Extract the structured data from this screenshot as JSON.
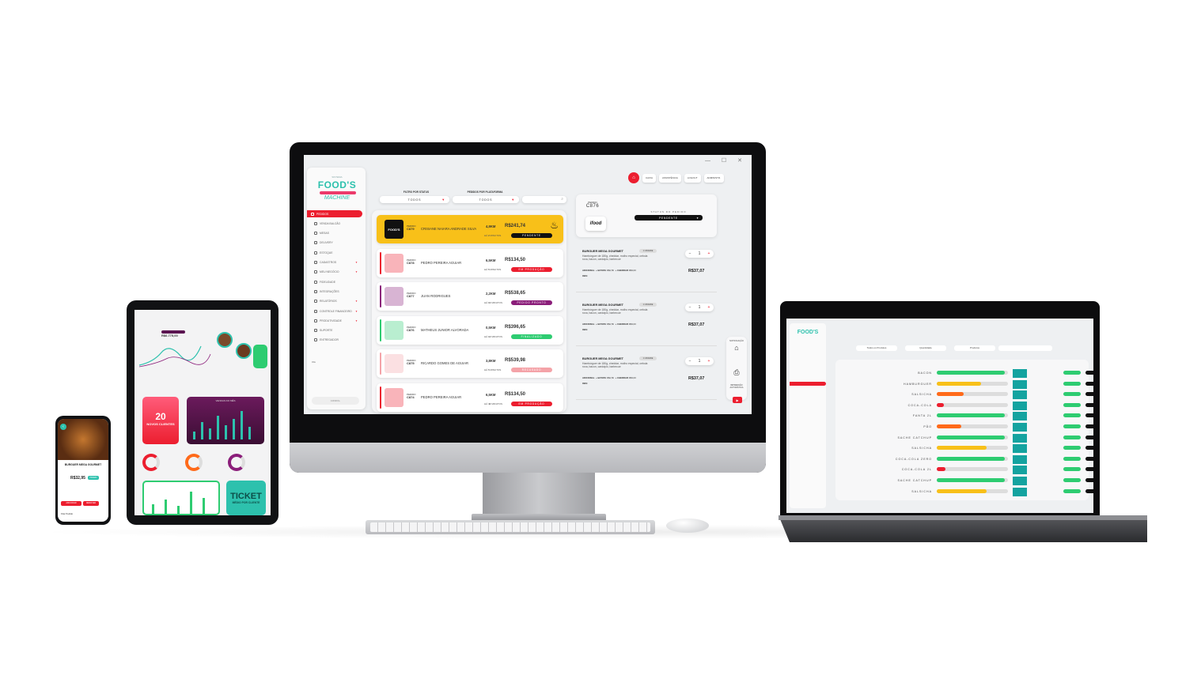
{
  "brand": {
    "top": "SISTEMA",
    "main": "FOOD'S",
    "sub": "MACHINE"
  },
  "monitor": {
    "window_controls": "— ☐ ✕",
    "topbar": [
      "CAIXA",
      "ASSISTÊNCIA",
      "LOGOUT",
      "ADMINISTR."
    ],
    "sidebar": {
      "items": [
        {
          "label": "PEDIDOS",
          "active": true
        },
        {
          "label": "VENDA BALCÃO"
        },
        {
          "label": "MESAS"
        },
        {
          "label": "DELIVERY"
        },
        {
          "label": "ESTOQUE"
        },
        {
          "label": "CADASTROS",
          "caret": true
        },
        {
          "label": "MEU NEGÓCIO",
          "caret": true
        },
        {
          "label": "FIDELIDADE"
        },
        {
          "label": "INTEGRAÇÕES"
        },
        {
          "label": "RELATÓRIOS",
          "caret": true
        },
        {
          "label": "CONTROLE FINANCEIRO",
          "caret": true
        },
        {
          "label": "PRODUTIVIDADE",
          "caret": true
        },
        {
          "label": "SUPORTE"
        },
        {
          "label": "ENTREGADOR"
        }
      ],
      "user": "Olá",
      "footer": "CONFIG."
    },
    "filters": {
      "status_label": "FILTRO POR STATUS",
      "status_value": "TODOS",
      "platform_label": "PEDIDOS POR PLATAFORMA",
      "platform_value": "TODOS",
      "search_icon": "magnifier-icon"
    },
    "orders": [
      {
        "pedido": "PEDIDO",
        "num": "C879",
        "name": "CRISIANE NAIARA ANDRADE SILVA",
        "dist": "4,9KM",
        "price": "R$241,74",
        "time_pre": "HÁ",
        "time_num": "2",
        "time_post": "MINUTOS",
        "status": "PENDENTE",
        "status_color": "#111111",
        "bar_color": "#f8c019",
        "selected": true
      },
      {
        "pedido": "PEDIDO",
        "num": "C878",
        "name": "PEDRO PEREIRA AGUIAR",
        "dist": "6,5KM",
        "price": "R$134,50",
        "time_pre": "HÁ",
        "time_num": "5",
        "time_post": "MINUTOS",
        "status": "EM PRODUÇÃO",
        "status_color": "#ec1e2f",
        "bar_color": "#ec1e2f"
      },
      {
        "pedido": "PEDIDO",
        "num": "C877",
        "name": "JUAN RODRIGUES",
        "dist": "2,2KM",
        "price": "R$538,65",
        "time_pre": "HÁ",
        "time_num": "10",
        "time_post": "MINUTOS",
        "status": "PEDIDO PRONTO",
        "status_color": "#8b1e7a",
        "bar_color": "#8b1e7a"
      },
      {
        "pedido": "PEDIDO",
        "num": "C876",
        "name": "MATHEUS JUNIOR ALVORADA",
        "dist": "0,5KM",
        "price": "R$396,65",
        "time_pre": "HÁ",
        "time_num": "12",
        "time_post": "MINUTOS",
        "status": "FINALIZADO",
        "status_color": "#2ecc71",
        "bar_color": "#2ecc71"
      },
      {
        "pedido": "PEDIDO",
        "num": "C875",
        "name": "RICARDO GOMES DE AGUIAR",
        "dist": "3,8KM",
        "price": "R$539,98",
        "time_pre": "HÁ",
        "time_num": "5",
        "time_post": "MINUTOS",
        "status": "RECUSADO",
        "status_color": "#f4a3a8",
        "bar_color": "#f4a3a8"
      },
      {
        "pedido": "PEDIDO",
        "num": "C874",
        "name": "PEDRO PEREIRA AGUIAR",
        "dist": "6,5KM",
        "price": "R$134,50",
        "time_pre": "HÁ",
        "time_num": "42",
        "time_post": "MINUTOS",
        "status": "EM PRODUÇÃO",
        "status_color": "#ec1e2f",
        "bar_color": "#ec1e2f"
      }
    ],
    "detail": {
      "pedido_label": "PEDIDO",
      "pedido_num": "C876",
      "platform": "ifood",
      "status_label": "STATUS DO PEDIDO",
      "status_value": "PENDENTE",
      "items": [
        {
          "title": "BURGUER MEGA GOURMET",
          "tag": "1 UNIDADE",
          "desc": "Hambúrguer de 180g, cheddar, molho especial, cebola roxa, bacon, cardápio, barbecue",
          "adicional": "ADICIONAL",
          "add1": "+ BATATA",
          "add1v": "R$2,50",
          "add2": "+ CHEDDAR",
          "add2v": "R$3,00",
          "obs": "OBS:",
          "qty": "1",
          "price": "R$37,07"
        },
        {
          "title": "BURGUER MEGA GOURMET",
          "tag": "1 UNIDADE",
          "desc": "Hambúrguer de 180g, cheddar, molho especial, cebola roxa, bacon, cardápio, barbecue",
          "adicional": "ADICIONAL",
          "add1": "+ BATATA",
          "add1v": "R$2,50",
          "add2": "+ CHEDDAR",
          "add2v": "R$3,00",
          "obs": "OBS:",
          "qty": "1",
          "price": "R$37,07"
        },
        {
          "title": "BURGUER MEGA GOURMET",
          "tag": "1 UNIDADE",
          "desc": "Hambúrguer de 180g, cheddar, molho especial, cebola roxa, bacon, cardápio, barbecue",
          "adicional": "ADICIONAL",
          "add1": "+ BATATA",
          "add1v": "R$2,50",
          "add2": "+ CHEDDAR",
          "add2v": "R$3,00",
          "obs": "OBS:",
          "qty": "1",
          "price": "R$37,07"
        }
      ],
      "tools": {
        "top": "NOTIFICAÇÃO",
        "bottom": "IMPRESSÃO AUTOMÁTICA"
      }
    }
  },
  "tablet": {
    "revenue": "R$6.775,00",
    "big_number": "20",
    "big_label": "NOVOS CLIENTES",
    "ticket_title": "TICKET",
    "ticket_sub": "MÉDIO POR CLIENTE",
    "chart_title": "VENDAS DO MÊS"
  },
  "phone": {
    "product": "BURGUER MEGA GOURMET",
    "price": "R$32,95",
    "badge": "PROMO",
    "btn1": "ADICIONAR",
    "btn2": "REMOVER",
    "note": "Fitar Pedido"
  },
  "laptop": {
    "filters": [
      "Todos os Produtos",
      "Quantidade",
      "Produtos"
    ],
    "stock": [
      {
        "name": "BACON",
        "pct": 96,
        "color": "#2ecc71"
      },
      {
        "name": "HAMBURGUER",
        "pct": 62,
        "color": "#f8c019"
      },
      {
        "name": "SALSICHA",
        "pct": 38,
        "color": "#ff6a1a"
      },
      {
        "name": "COCA-COLA",
        "pct": 10,
        "color": "#ec1e2f"
      },
      {
        "name": "FANTA 2L",
        "pct": 96,
        "color": "#2ecc71"
      },
      {
        "name": "PÃO",
        "pct": 34,
        "color": "#ff6a1a"
      },
      {
        "name": "SACHE CATCHUP",
        "pct": 96,
        "color": "#2ecc71"
      },
      {
        "name": "SALSICHA",
        "pct": 70,
        "color": "#f8c019"
      },
      {
        "name": "COCA-COLA ZERO",
        "pct": 96,
        "color": "#2ecc71"
      },
      {
        "name": "COCA-COLA 2L",
        "pct": 12,
        "color": "#ec1e2f"
      },
      {
        "name": "SACHE CATCHUP",
        "pct": 96,
        "color": "#2ecc71"
      },
      {
        "name": "SALSICHA",
        "pct": 70,
        "color": "#f8c019"
      }
    ]
  }
}
